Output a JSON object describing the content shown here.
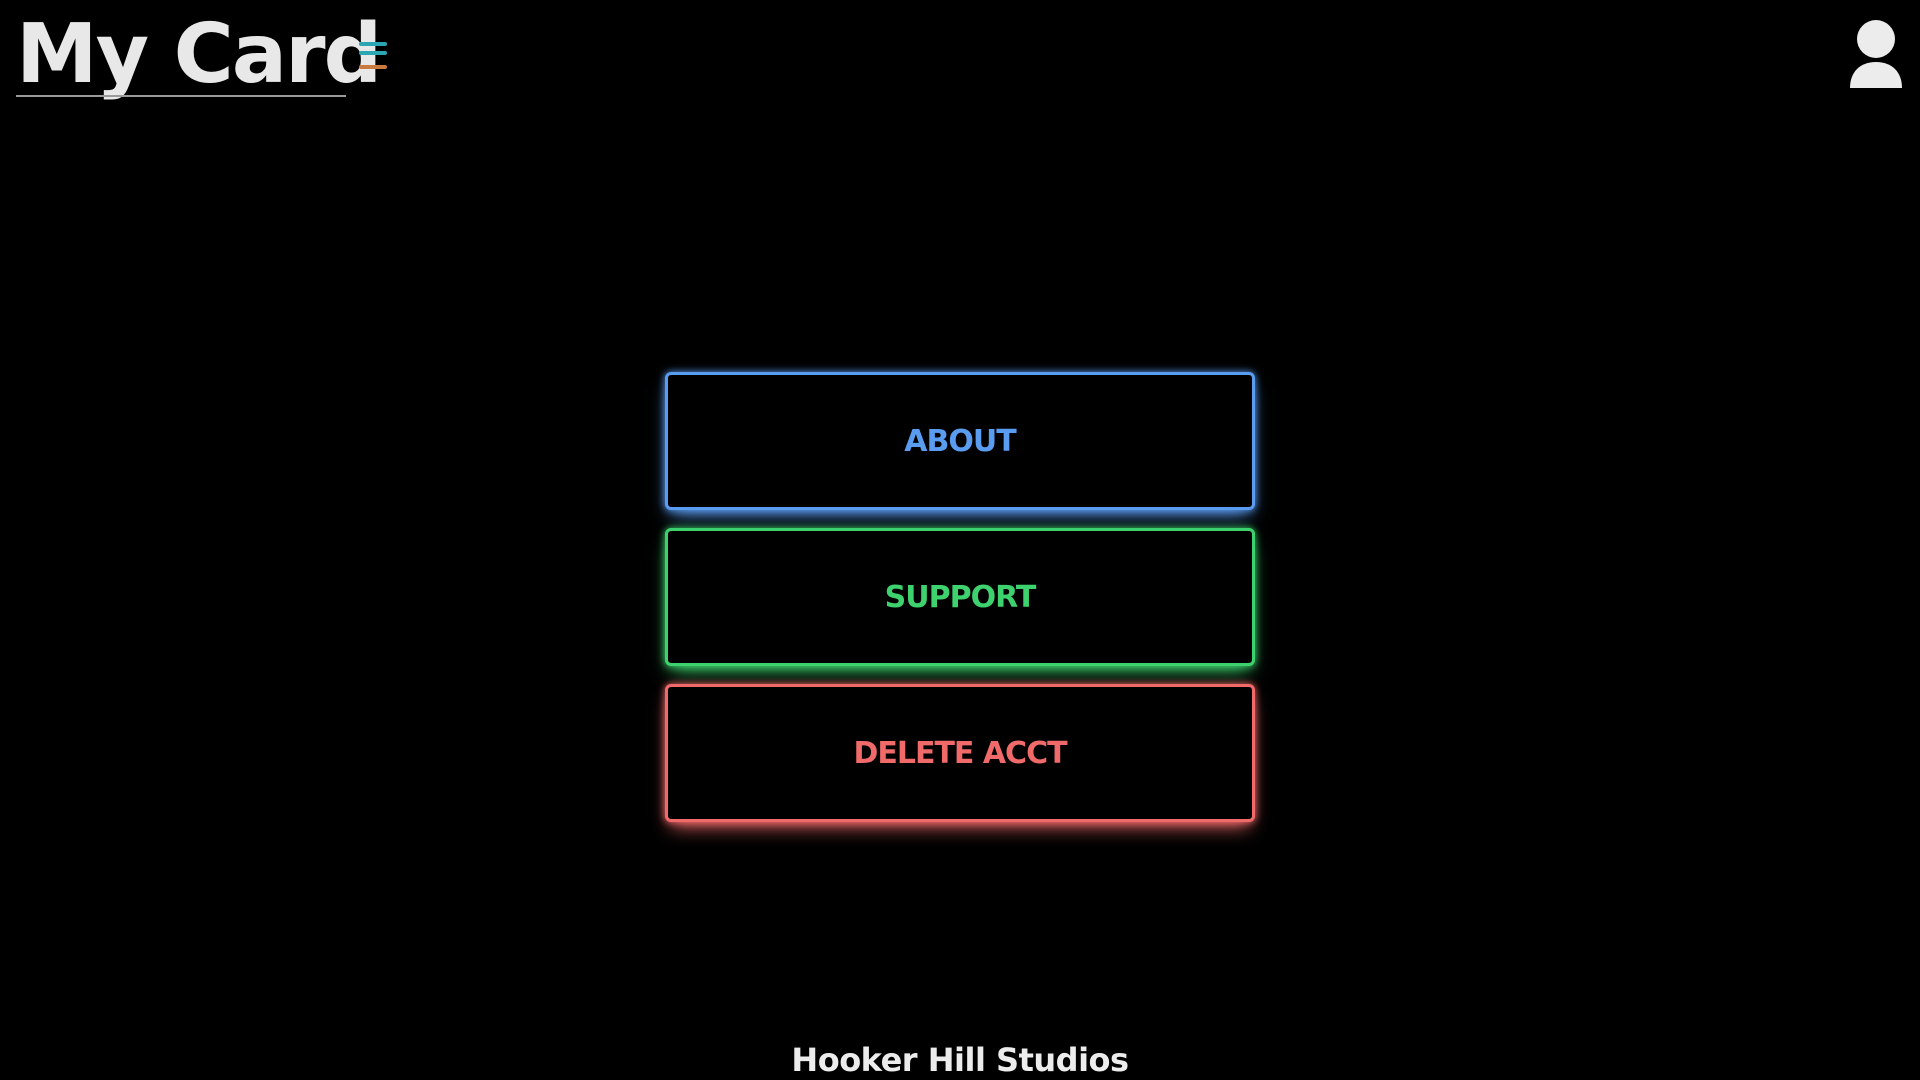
{
  "header": {
    "title": "My Card",
    "menu_icon": "hamburger-menu-icon",
    "user_icon": "user-account-icon"
  },
  "menu": {
    "buttons": [
      {
        "label": "ABOUT",
        "color": "#5a9cf0"
      },
      {
        "label": "SUPPORT",
        "color": "#3ed26e"
      },
      {
        "label": "DELETE ACCT",
        "color": "#f06a6a"
      }
    ]
  },
  "colors": {
    "background": "#000000",
    "title_text": "#e8e8e8",
    "menu_icon_teal": "#2aa7b3",
    "menu_icon_orange": "#c97a3f"
  },
  "footer": {
    "text": "Hooker Hill Studios"
  }
}
